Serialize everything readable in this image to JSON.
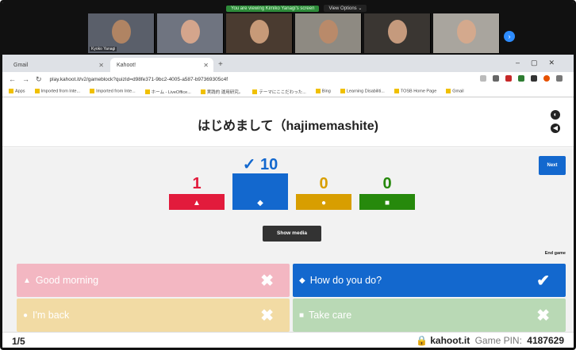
{
  "zoom": {
    "share_banner": "You are viewing Kimiko Yanagi's screen",
    "view_options": "View Options ⌄",
    "participants": [
      {
        "name": "Kyoko Yanagi",
        "bg": "#5a5f6a",
        "face": "#b08463"
      },
      {
        "name": "",
        "bg": "#6f7480",
        "face": "#d4a58c"
      },
      {
        "name": "",
        "bg": "#4a3b30",
        "face": "#c79a78"
      },
      {
        "name": "",
        "bg": "#8e8a82",
        "face": "#b98a6a"
      },
      {
        "name": "",
        "bg": "#3a3632",
        "face": "#c59a7d"
      },
      {
        "name": "",
        "bg": "#a9a59e",
        "face": "#d4a98d"
      }
    ]
  },
  "browser": {
    "tabs": [
      {
        "label": "Gmail"
      },
      {
        "label": "Kahoot!"
      }
    ],
    "url": "play.kahoot.it/v2/gameblock?quizId=d98fe371-9bc2-4005-a587-b97369305c4f",
    "bookmarks": [
      "Apps",
      "Imported from Inte...",
      "Imported from Inte...",
      "ホーム - LiveOffice...",
      "実践的 運用研究。",
      "テーマにここだわった...",
      "Bing",
      "Learning Disabiliti...",
      "TOSB Home Page",
      "Gmail"
    ]
  },
  "kahoot": {
    "question": "はじめまして（hajimemashite)",
    "next_label": "Next",
    "show_media_label": "Show media",
    "end_game_label": "End game",
    "results": [
      {
        "label": "1",
        "count": 1,
        "color": "#e21b3c",
        "shape": "▲",
        "correct": false
      },
      {
        "label": "✓ 10",
        "count": 10,
        "color": "#1368ce",
        "shape": "◆",
        "correct": true
      },
      {
        "label": "0",
        "count": 0,
        "color": "#d89e00",
        "shape": "●",
        "correct": false
      },
      {
        "label": "0",
        "count": 0,
        "color": "#26890c",
        "shape": "■",
        "correct": false
      }
    ],
    "answers": [
      {
        "text": "Good morning",
        "shape": "▲",
        "mark": "✖",
        "color": "#f3b7c2"
      },
      {
        "text": "How do you do?",
        "shape": "◆",
        "mark": "✔",
        "color": "#1368ce"
      },
      {
        "text": "I'm back",
        "shape": "●",
        "mark": "✖",
        "color": "#f2dba4"
      },
      {
        "text": "Take care",
        "shape": "■",
        "mark": "✖",
        "color": "#b9d9b5"
      }
    ],
    "progress": "1/5",
    "brand": "kahoot.it",
    "pin_label": "Game PIN:",
    "pin": "4187629"
  }
}
